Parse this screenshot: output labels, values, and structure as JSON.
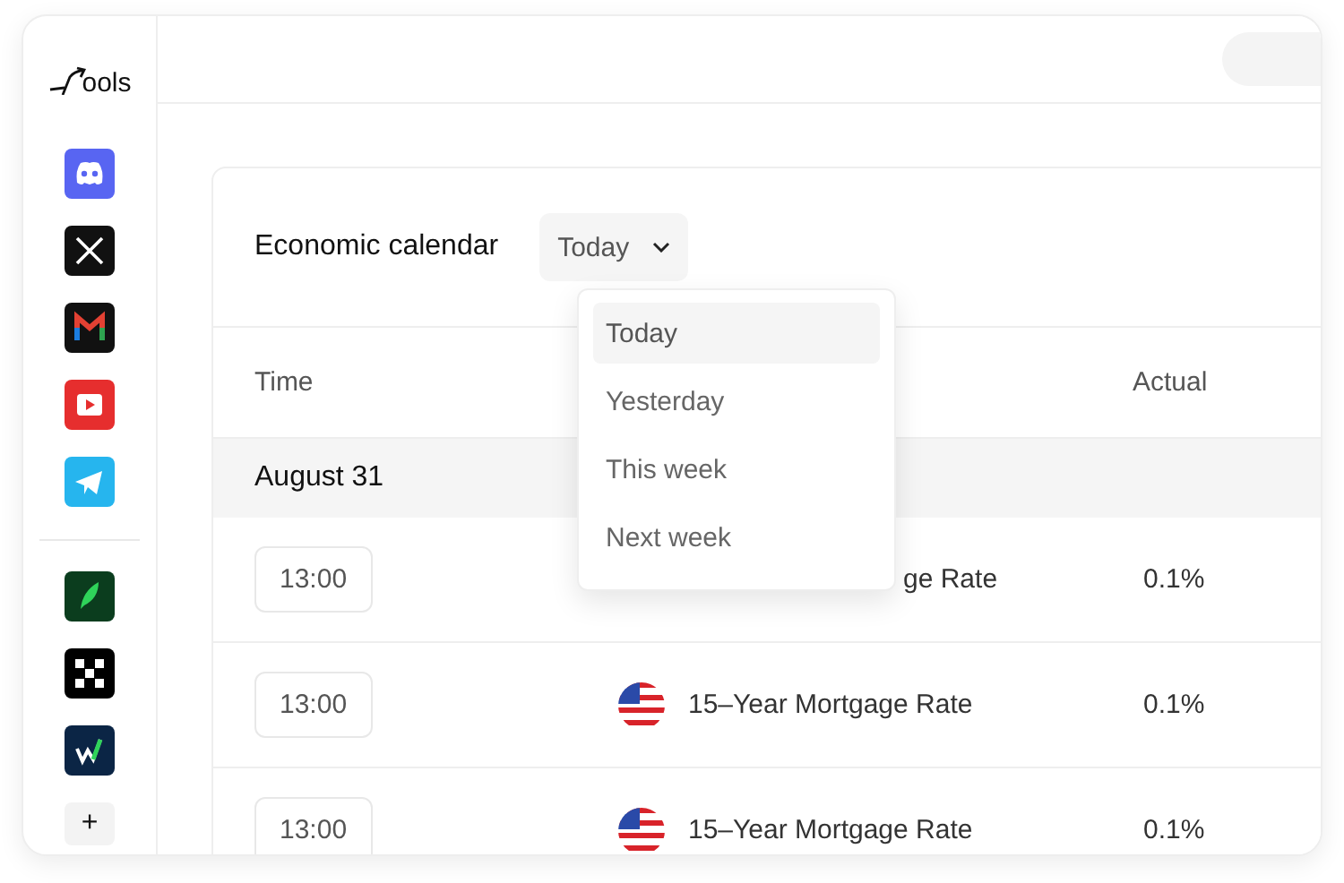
{
  "sidebar": {
    "logo": "ools",
    "apps": [
      {
        "kind": "discord"
      },
      {
        "kind": "x"
      },
      {
        "kind": "gmail"
      },
      {
        "kind": "youtube"
      },
      {
        "kind": "telegram"
      }
    ],
    "tools": [
      {
        "kind": "feather"
      },
      {
        "kind": "checker"
      },
      {
        "kind": "chart"
      }
    ],
    "add_label": "+"
  },
  "calendar": {
    "title": "Economic calendar",
    "period": {
      "value": "Today",
      "expanded": true
    },
    "options": [
      {
        "label": "Today",
        "selected": true
      },
      {
        "label": "Yesterday",
        "selected": false
      },
      {
        "label": "This week",
        "selected": false
      },
      {
        "label": "Next week",
        "selected": false
      }
    ],
    "columns": [
      "Time",
      "Actual"
    ],
    "date": "August 31",
    "rows": [
      {
        "time": "13:00",
        "event": "ge Rate",
        "flag": false,
        "actual": "0.1%"
      },
      {
        "time": "13:00",
        "event": "15–Year Mortgage Rate",
        "flag": true,
        "actual": "0.1%"
      },
      {
        "time": "13:00",
        "event": "15–Year Mortgage Rate",
        "flag": true,
        "actual": "0.1%"
      }
    ]
  }
}
